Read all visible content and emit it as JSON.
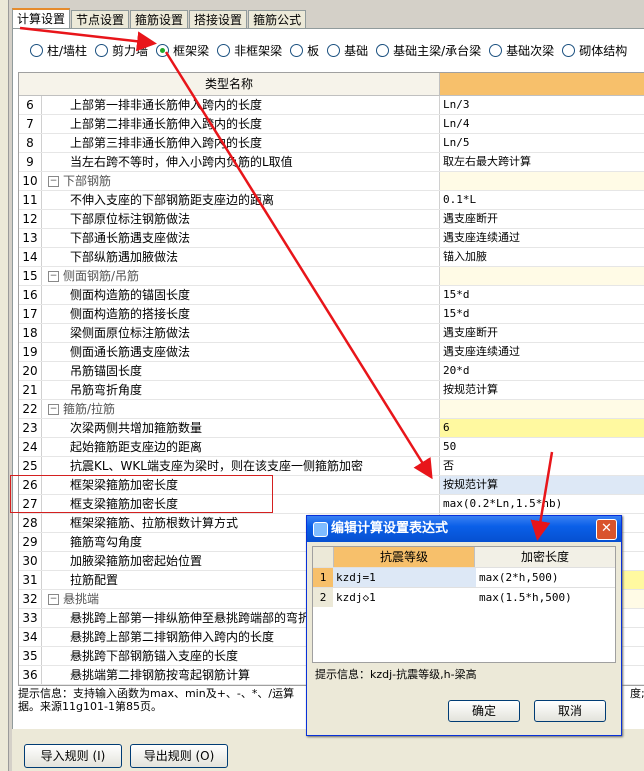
{
  "tabs": [
    "计算设置",
    "节点设置",
    "箍筋设置",
    "搭接设置",
    "箍筋公式"
  ],
  "radios": [
    "柱/墙柱",
    "剪力墙",
    "框架梁",
    "非框架梁",
    "板",
    "基础",
    "基础主梁/承台梁",
    "基础次梁",
    "砌体结构"
  ],
  "grid": {
    "col_name": "类型名称",
    "rows": [
      {
        "n": "6",
        "name": "上部第一排非通长筋伸入跨内的长度",
        "val": "Ln/3"
      },
      {
        "n": "7",
        "name": "上部第二排非通长筋伸入跨内的长度",
        "val": "Ln/4"
      },
      {
        "n": "8",
        "name": "上部第三排非通长筋伸入跨内的长度",
        "val": "Ln/5"
      },
      {
        "n": "9",
        "name": "当左右跨不等时，伸入小跨内负筋的L取值",
        "val": "取左右最大跨计算"
      },
      {
        "n": "10",
        "name": "下部钢筋",
        "val": "",
        "grp": true
      },
      {
        "n": "11",
        "name": "不伸入支座的下部钢筋距支座边的距离",
        "val": "0.1*L"
      },
      {
        "n": "12",
        "name": "下部原位标注钢筋做法",
        "val": "遇支座断开"
      },
      {
        "n": "13",
        "name": "下部通长筋遇支座做法",
        "val": "遇支座连续通过"
      },
      {
        "n": "14",
        "name": "下部纵筋遇加腋做法",
        "val": "锚入加腋"
      },
      {
        "n": "15",
        "name": "侧面钢筋/吊筋",
        "val": "",
        "grp": true
      },
      {
        "n": "16",
        "name": "侧面构造筋的锚固长度",
        "val": "15*d"
      },
      {
        "n": "17",
        "name": "侧面构造筋的搭接长度",
        "val": "15*d"
      },
      {
        "n": "18",
        "name": "梁侧面原位标注筋做法",
        "val": "遇支座断开"
      },
      {
        "n": "19",
        "name": "侧面通长筋遇支座做法",
        "val": "遇支座连续通过"
      },
      {
        "n": "20",
        "name": "吊筋锚固长度",
        "val": "20*d"
      },
      {
        "n": "21",
        "name": "吊筋弯折角度",
        "val": "按规范计算"
      },
      {
        "n": "22",
        "name": "箍筋/拉筋",
        "val": "",
        "grp": true
      },
      {
        "n": "23",
        "name": "次梁两侧共增加箍筋数量",
        "val": "6",
        "ylw": true
      },
      {
        "n": "24",
        "name": "起始箍筋距支座边的距离",
        "val": "50"
      },
      {
        "n": "25",
        "name": "抗震KL、WKL端支座为梁时，则在该支座一侧箍筋加密",
        "val": "否"
      },
      {
        "n": "26",
        "name": "框架梁箍筋加密长度",
        "val": "按规范计算",
        "blu": true
      },
      {
        "n": "27",
        "name": "框支梁箍筋加密长度",
        "val": "max(0.2*Ln,1.5*hb)"
      },
      {
        "n": "28",
        "name": "框架梁箍筋、拉筋根数计算方式",
        "val": ""
      },
      {
        "n": "29",
        "name": "箍筋弯勾角度",
        "val": ""
      },
      {
        "n": "30",
        "name": "加腋梁箍筋加密起始位置",
        "val": ""
      },
      {
        "n": "31",
        "name": "拉筋配置",
        "val": "",
        "ylw": true
      },
      {
        "n": "32",
        "name": "悬挑端",
        "val": "",
        "grp": true
      },
      {
        "n": "33",
        "name": "悬挑跨上部第一排纵筋伸至悬挑跨端部的弯折",
        "val": ""
      },
      {
        "n": "34",
        "name": "悬挑跨上部第二排钢筋伸入跨内的长度",
        "val": ""
      },
      {
        "n": "35",
        "name": "悬挑跨下部钢筋锚入支座的长度",
        "val": ""
      },
      {
        "n": "36",
        "name": "悬挑端第二排钢筋按弯起钢筋计算",
        "val": ""
      }
    ]
  },
  "hint": {
    "line1": "提示信息：支持输入函数为max、min及+、-、*、/运算",
    "line2": "据。来源11g101-1第85页。",
    "right": "度;"
  },
  "buttons": {
    "import": "导入规则 (I)",
    "export": "导出规则 (O)"
  },
  "dialog": {
    "title": "编辑计算设置表达式",
    "col1": "抗震等级",
    "col2": "加密长度",
    "rows": [
      {
        "n": "1",
        "grade": "kzdj=1",
        "len": "max(2*h,500)"
      },
      {
        "n": "2",
        "grade": "kzdj◇1",
        "len": "max(1.5*h,500)"
      }
    ],
    "hint": "提示信息：kzdj-抗震等级,h-梁高",
    "ok": "确定",
    "cancel": "取消"
  },
  "colors": {
    "arrow": "#e8151a",
    "accent": "#f7c06b",
    "title": "#0a5fe8"
  }
}
